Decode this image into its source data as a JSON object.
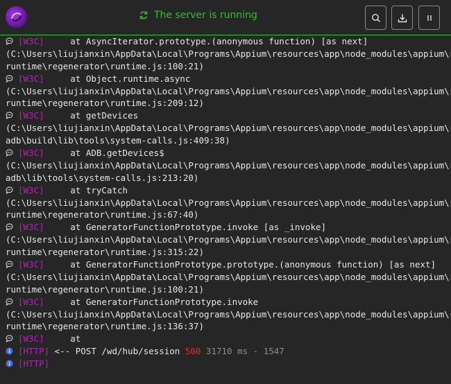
{
  "header": {
    "status_text": "The server is running",
    "buttons": [
      {
        "name": "search-button",
        "icon": "search-icon"
      },
      {
        "name": "download-button",
        "icon": "download-icon"
      },
      {
        "name": "pause-button",
        "icon": "pause-icon"
      }
    ],
    "accent_color": "#2fbf2f"
  },
  "log": {
    "entries": [
      {
        "type": "w3c",
        "tag": "[W3C]",
        "msg": "     at AsyncIterator.prototype.(anonymous function) [as next]",
        "cont": [
          "(C:\\Users\\liujianxin\\AppData\\Local\\Programs\\Appium\\resources\\app\\node_modules\\appium\\r",
          "runtime\\regenerator\\runtime.js:100:21)"
        ]
      },
      {
        "type": "w3c",
        "tag": "[W3C]",
        "msg": "     at Object.runtime.async",
        "cont": [
          "(C:\\Users\\liujianxin\\AppData\\Local\\Programs\\Appium\\resources\\app\\node_modules\\appium\\r",
          "runtime\\regenerator\\runtime.js:209:12)"
        ]
      },
      {
        "type": "w3c",
        "tag": "[W3C]",
        "msg": "     at getDevices",
        "cont": [
          "(C:\\Users\\liujianxin\\AppData\\Local\\Programs\\Appium\\resources\\app\\node_modules\\appium\\r",
          "adb\\build\\lib\\tools\\system-calls.js:409:38)"
        ]
      },
      {
        "type": "w3c",
        "tag": "[W3C]",
        "msg": "     at ADB.getDevices$",
        "cont": [
          "(C:\\Users\\liujianxin\\AppData\\Local\\Programs\\Appium\\resources\\app\\node_modules\\appium\\r",
          "adb\\lib\\tools\\system-calls.js:213:20)"
        ]
      },
      {
        "type": "w3c",
        "tag": "[W3C]",
        "msg": "     at tryCatch",
        "cont": [
          "(C:\\Users\\liujianxin\\AppData\\Local\\Programs\\Appium\\resources\\app\\node_modules\\appium\\r",
          "runtime\\regenerator\\runtime.js:67:40)"
        ]
      },
      {
        "type": "w3c",
        "tag": "[W3C]",
        "msg": "     at GeneratorFunctionPrototype.invoke [as _invoke]",
        "cont": [
          "(C:\\Users\\liujianxin\\AppData\\Local\\Programs\\Appium\\resources\\app\\node_modules\\appium\\r",
          "runtime\\regenerator\\runtime.js:315:22)"
        ]
      },
      {
        "type": "w3c",
        "tag": "[W3C]",
        "msg": "     at GeneratorFunctionPrototype.prototype.(anonymous function) [as next]",
        "cont": [
          "(C:\\Users\\liujianxin\\AppData\\Local\\Programs\\Appium\\resources\\app\\node_modules\\appium\\r",
          "runtime\\regenerator\\runtime.js:100:21)"
        ]
      },
      {
        "type": "w3c",
        "tag": "[W3C]",
        "msg": "     at GeneratorFunctionPrototype.invoke",
        "cont": [
          "(C:\\Users\\liujianxin\\AppData\\Local\\Programs\\Appium\\resources\\app\\node_modules\\appium\\r",
          "runtime\\regenerator\\runtime.js:136:37)"
        ]
      },
      {
        "type": "w3c",
        "tag": "[W3C]",
        "msg": "     at",
        "cont": []
      },
      {
        "type": "http",
        "tag": "[HTTP]",
        "msg": " <-- POST /wd/hub/session ",
        "status": "500",
        "timing": " 31710 ms - 1547",
        "cont": []
      },
      {
        "type": "http",
        "tag": "[HTTP]",
        "msg": "",
        "cont": []
      }
    ]
  }
}
